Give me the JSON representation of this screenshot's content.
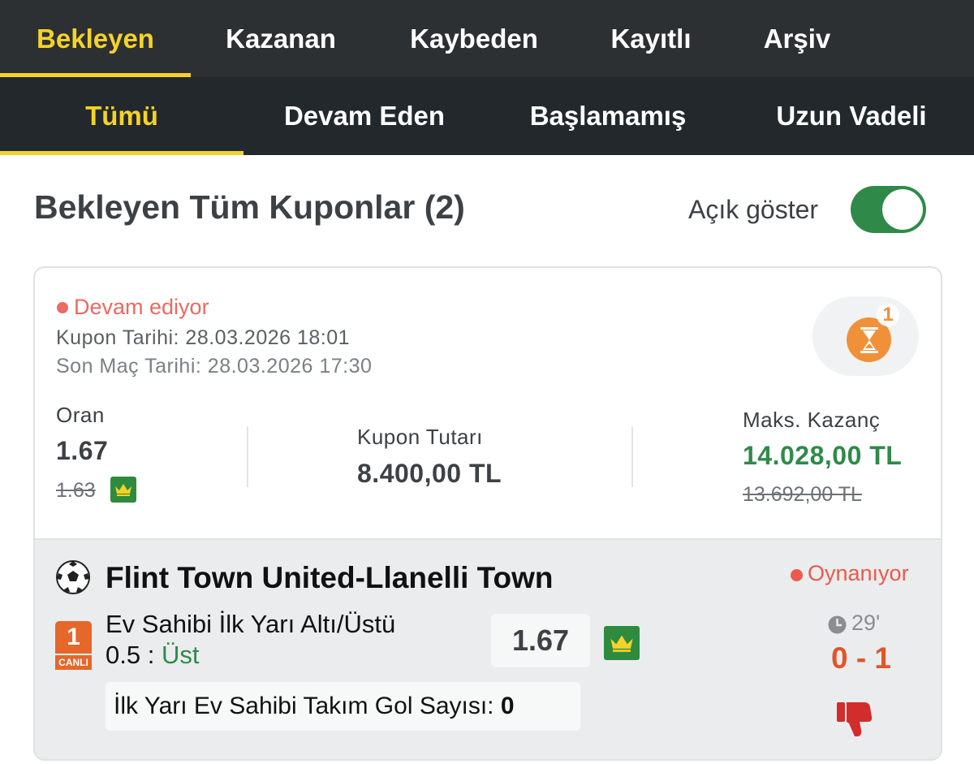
{
  "top_tabs": [
    "Bekleyen",
    "Kazanan",
    "Kaybeden",
    "Kayıtlı",
    "Arşiv"
  ],
  "sub_tabs": [
    "Tümü",
    "Devam Eden",
    "Başlamamış",
    "Uzun Vadeli"
  ],
  "page_title": "Bekleyen Tüm Kuponlar (2)",
  "toggle": {
    "label": "Açık göster",
    "on": true
  },
  "coupon": {
    "status": "Devam ediyor",
    "coupon_date": "Kupon Tarihi: 28.03.2026 18:01",
    "last_match_date": "Son Maç Tarihi: 28.03.2026 17:30",
    "pending_count": "1",
    "odds_label": "Oran",
    "odds": "1.67",
    "odds_old": "1.63",
    "amount_label": "Kupon Tutarı",
    "amount": "8.400,00 TL",
    "max_win_label": "Maks. Kazanç",
    "max_win": "14.028,00 TL",
    "max_win_old": "13.692,00 TL"
  },
  "match": {
    "title": "Flint Town United-Llanelli Town",
    "live_status": "Oynanıyor",
    "badge_number": "1",
    "badge_label": "CANLI",
    "market": "Ev Sahibi İlk Yarı Altı/Üstü",
    "line": "0.5 :",
    "pick": "Üst",
    "odd": "1.67",
    "minute": "29'",
    "score": "0 - 1",
    "info_label": "İlk Yarı Ev Sahibi Takım Gol Sayısı:",
    "info_value": "0"
  },
  "colors": {
    "accent": "#f5d22a",
    "header_bg": "#2c3033",
    "subheader_bg": "#22282b",
    "green": "#2f8a49",
    "live_red": "#ea5a4c",
    "score_orange": "#e0552a",
    "hourglass_orange": "#f0913a"
  },
  "icons": [
    "hourglass-icon",
    "crown-icon",
    "soccer-ball-icon",
    "clock-icon",
    "thumbs-down-icon"
  ]
}
